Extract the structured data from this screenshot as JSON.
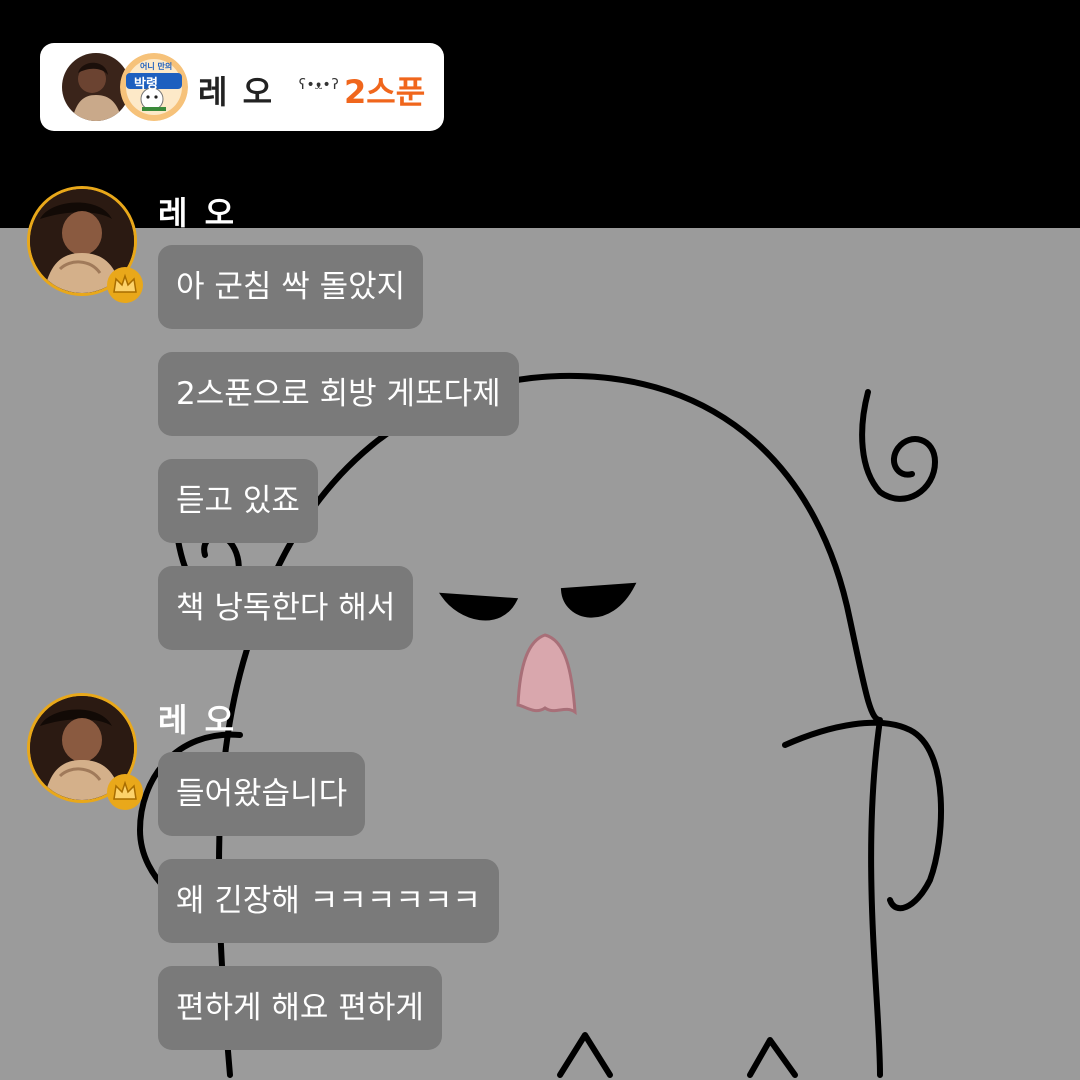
{
  "header": {
    "name": "레 오",
    "emoticon": "ʕ•ᴥ•ʔ",
    "status": "2스푼",
    "badge_text_top": "어니 만의",
    "badge_text_main": "박령"
  },
  "groups": [
    {
      "sender": "레 오",
      "messages": [
        "아 군침 싹 돌았지",
        "2스푼으로 회방 게또다제",
        "듣고 있죠",
        "책 낭독한다 해서"
      ]
    },
    {
      "sender": "레 오",
      "messages": [
        "들어왔습니다",
        "왜 긴장해 ㅋㅋㅋㅋㅋㅋ",
        "편하게 해요 편하게"
      ]
    }
  ],
  "colors": {
    "accent": "#f0661c",
    "bubble": "#7a7a7a",
    "avatar_ring": "#e9a81a",
    "background": "#9b9b9b"
  },
  "icons": [
    "crown-icon",
    "ghost-illustration"
  ]
}
